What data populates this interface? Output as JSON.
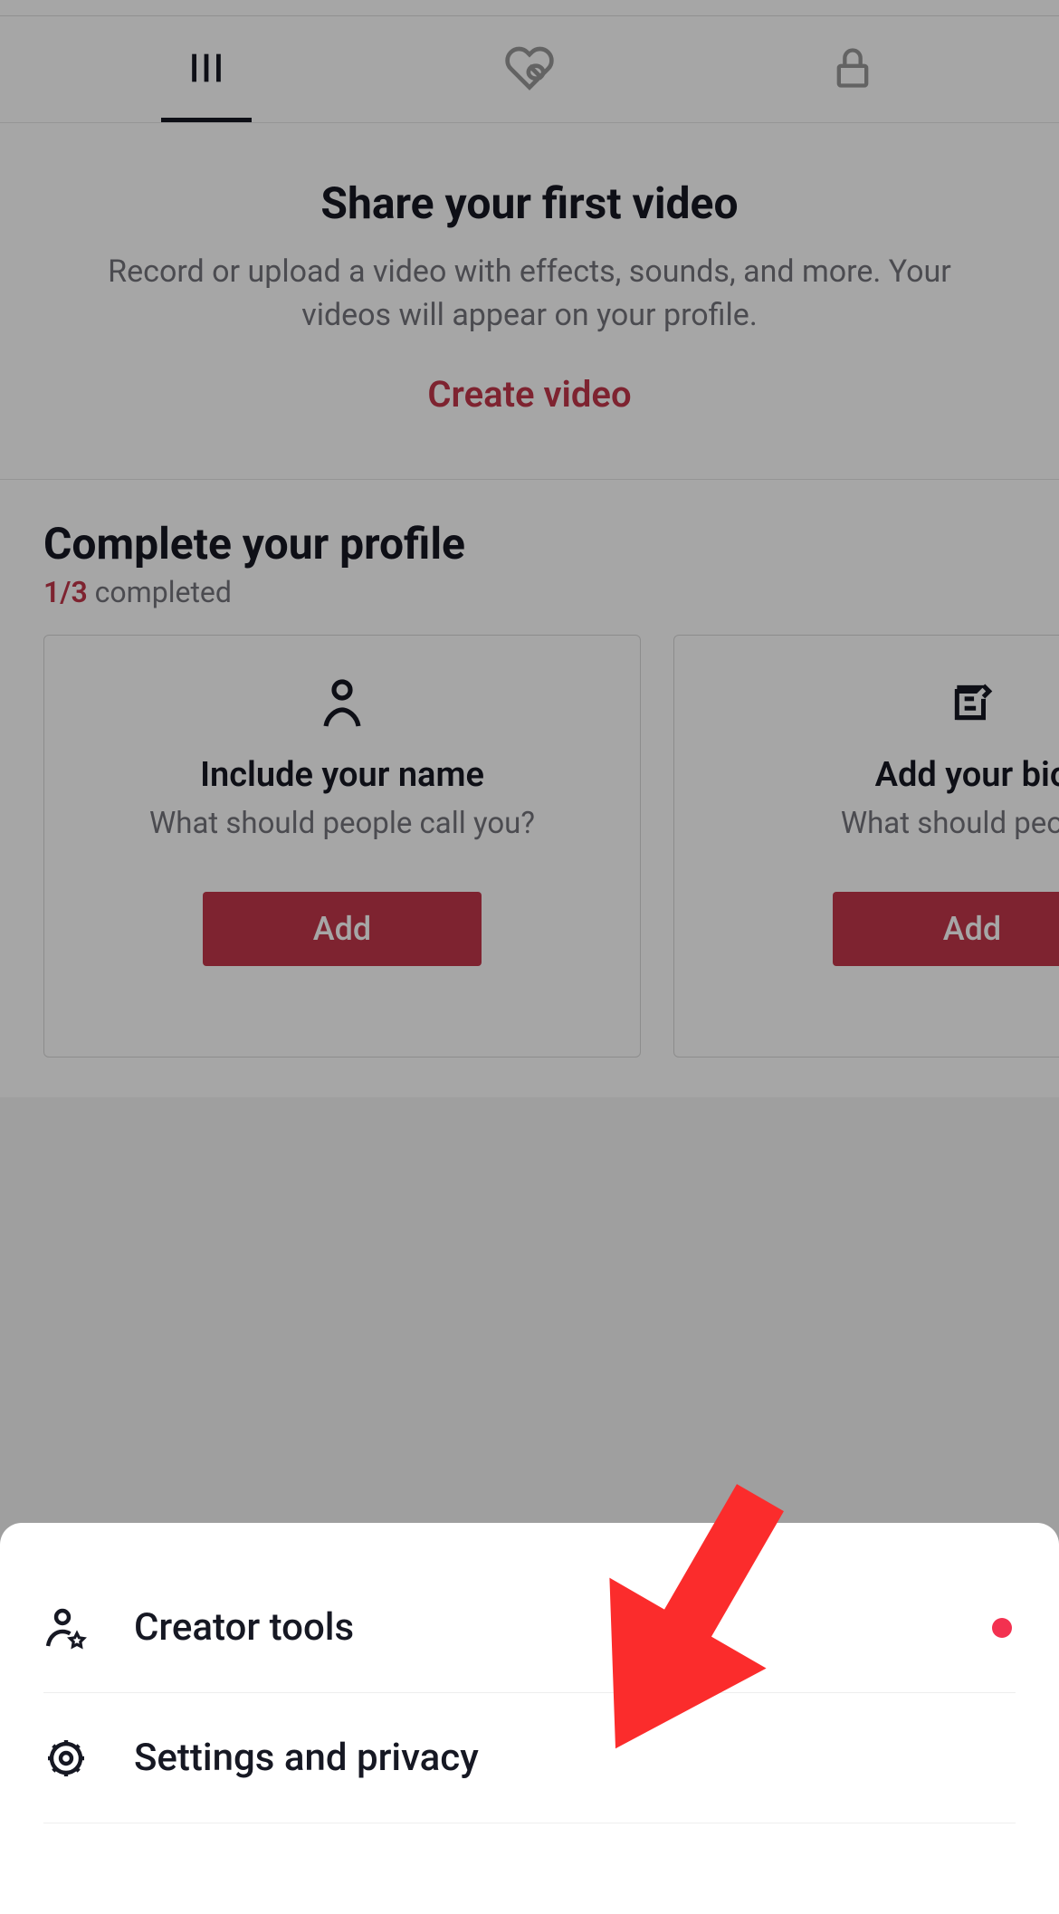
{
  "tabs": {
    "grid": "grid-tab",
    "liked": "liked-tab",
    "private": "private-tab"
  },
  "empty_state": {
    "title": "Share your first video",
    "desc": "Record or upload a video with effects, sounds, and more. Your videos will appear on your profile.",
    "action": "Create video"
  },
  "complete": {
    "title": "Complete your profile",
    "progress_count": "1/3",
    "progress_label": " completed"
  },
  "cards": [
    {
      "title": "Include your name",
      "desc": "What should people call you?",
      "btn": "Add"
    },
    {
      "title": "Add your bio",
      "desc": "What should people",
      "btn": "Add"
    }
  ],
  "sheet": {
    "items": [
      {
        "label": "Creator tools"
      },
      {
        "label": "Settings and privacy"
      }
    ]
  },
  "colors": {
    "accent": "#c2374a",
    "dot": "#f33150"
  }
}
